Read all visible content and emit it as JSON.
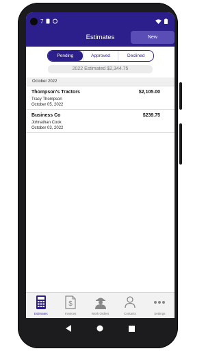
{
  "status_bar": {
    "time": "7"
  },
  "app_bar": {
    "title": "Estimates",
    "new_label": "New"
  },
  "filters": {
    "tabs": [
      "Pending",
      "Approved",
      "Declined"
    ],
    "active": "Pending"
  },
  "summary": {
    "text": "2022  Estimated $2,344.75"
  },
  "section": {
    "month": "October 2022"
  },
  "estimates": [
    {
      "client": "Thompson's Tractors",
      "amount": "$2,105.00",
      "contact": "Tracy Thompson",
      "date": "October 05, 2022"
    },
    {
      "client": "Business Co",
      "amount": "$239.75",
      "contact": "Johnathan Cook",
      "date": "October 03, 2022"
    }
  ],
  "tab_bar": {
    "items": [
      {
        "label": "Estimates",
        "icon": "calculator-icon"
      },
      {
        "label": "Invoices",
        "icon": "invoice-icon"
      },
      {
        "label": "Work Orders",
        "icon": "worker-icon"
      },
      {
        "label": "Contacts",
        "icon": "person-icon"
      },
      {
        "label": "Settings",
        "icon": "more-icon"
      }
    ],
    "active": "Estimates"
  },
  "colors": {
    "primary": "#2c1f8c",
    "new_button": "#5a4db5"
  }
}
